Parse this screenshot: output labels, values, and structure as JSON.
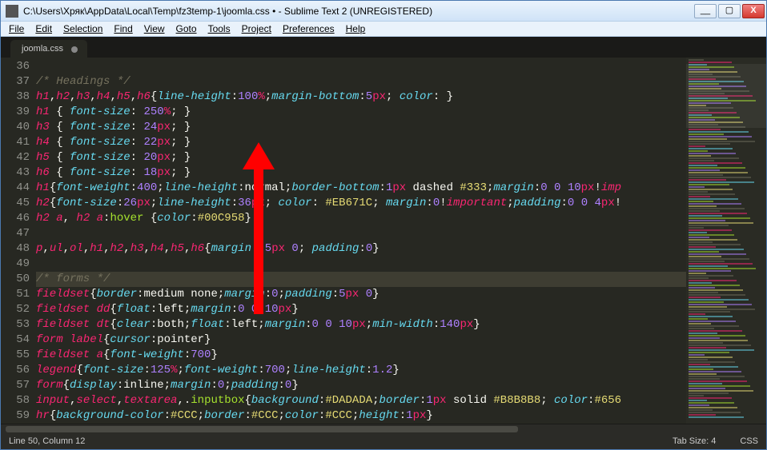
{
  "window": {
    "title": "C:\\Users\\Хряк\\AppData\\Local\\Temp\\fz3temp-1\\joomla.css • - Sublime Text 2 (UNREGISTERED)",
    "minimize": "__",
    "maximize": "▢",
    "close": "X"
  },
  "menu": {
    "file": "File",
    "edit": "Edit",
    "selection": "Selection",
    "find": "Find",
    "view": "View",
    "goto": "Goto",
    "tools": "Tools",
    "project": "Project",
    "preferences": "Preferences",
    "help": "Help"
  },
  "tab": {
    "name": "joomla.css"
  },
  "gutter_start": 36,
  "current_line": 50,
  "status": {
    "left": "Line 50, Column 12",
    "tabsize": "Tab Size: 4",
    "syntax": "CSS"
  },
  "code": [
    {
      "num": 36,
      "tokens": [
        [
          "",
          ""
        ]
      ]
    },
    {
      "num": 37,
      "tokens": [
        [
          "c-comment",
          "/* Headings */"
        ]
      ]
    },
    {
      "num": 38,
      "tokens": [
        [
          "c-sel",
          "h1"
        ],
        [
          "c-punc",
          ","
        ],
        [
          "c-sel",
          "h2"
        ],
        [
          "c-punc",
          ","
        ],
        [
          "c-sel",
          "h3"
        ],
        [
          "c-punc",
          ","
        ],
        [
          "c-sel",
          "h4"
        ],
        [
          "c-punc",
          ","
        ],
        [
          "c-sel",
          "h5"
        ],
        [
          "c-punc",
          ","
        ],
        [
          "c-sel",
          "h6"
        ],
        [
          "c-punc",
          "{"
        ],
        [
          "c-prop",
          "line-height"
        ],
        [
          "c-punc",
          ":"
        ],
        [
          "c-num",
          "100"
        ],
        [
          "c-unit",
          "%"
        ],
        [
          "c-punc",
          ";"
        ],
        [
          "c-prop",
          "margin-bottom"
        ],
        [
          "c-punc",
          ":"
        ],
        [
          "c-num",
          "5"
        ],
        [
          "c-unit",
          "px"
        ],
        [
          "c-punc",
          "; "
        ],
        [
          "c-prop",
          "color"
        ],
        [
          "c-punc",
          ": }"
        ]
      ]
    },
    {
      "num": 39,
      "tokens": [
        [
          "c-sel",
          "h1"
        ],
        [
          "c-punc",
          " { "
        ],
        [
          "c-prop",
          "font-size"
        ],
        [
          "c-punc",
          ": "
        ],
        [
          "c-num",
          "250"
        ],
        [
          "c-unit",
          "%"
        ],
        [
          "c-punc",
          "; }"
        ]
      ]
    },
    {
      "num": 40,
      "tokens": [
        [
          "c-sel",
          "h3"
        ],
        [
          "c-punc",
          " { "
        ],
        [
          "c-prop",
          "font-size"
        ],
        [
          "c-punc",
          ": "
        ],
        [
          "c-num",
          "24"
        ],
        [
          "c-unit",
          "px"
        ],
        [
          "c-punc",
          "; }"
        ]
      ]
    },
    {
      "num": 41,
      "tokens": [
        [
          "c-sel",
          "h4"
        ],
        [
          "c-punc",
          " { "
        ],
        [
          "c-prop",
          "font-size"
        ],
        [
          "c-punc",
          ": "
        ],
        [
          "c-num",
          "22"
        ],
        [
          "c-unit",
          "px"
        ],
        [
          "c-punc",
          "; }"
        ]
      ]
    },
    {
      "num": 42,
      "tokens": [
        [
          "c-sel",
          "h5"
        ],
        [
          "c-punc",
          " { "
        ],
        [
          "c-prop",
          "font-size"
        ],
        [
          "c-punc",
          ": "
        ],
        [
          "c-num",
          "20"
        ],
        [
          "c-unit",
          "px"
        ],
        [
          "c-punc",
          "; }"
        ]
      ]
    },
    {
      "num": 43,
      "tokens": [
        [
          "c-sel",
          "h6"
        ],
        [
          "c-punc",
          " { "
        ],
        [
          "c-prop",
          "font-size"
        ],
        [
          "c-punc",
          ": "
        ],
        [
          "c-num",
          "18"
        ],
        [
          "c-unit",
          "px"
        ],
        [
          "c-punc",
          "; }"
        ]
      ]
    },
    {
      "num": 44,
      "tokens": [
        [
          "c-sel",
          "h1"
        ],
        [
          "c-punc",
          "{"
        ],
        [
          "c-prop",
          "font-weight"
        ],
        [
          "c-punc",
          ":"
        ],
        [
          "c-num",
          "400"
        ],
        [
          "c-punc",
          ";"
        ],
        [
          "c-prop",
          "line-height"
        ],
        [
          "c-punc",
          ":normal;"
        ],
        [
          "c-prop",
          "border-bottom"
        ],
        [
          "c-punc",
          ":"
        ],
        [
          "c-num",
          "1"
        ],
        [
          "c-unit",
          "px"
        ],
        [
          "c-punc",
          " dashed "
        ],
        [
          "c-str",
          "#333"
        ],
        [
          "c-punc",
          ";"
        ],
        [
          "c-prop",
          "margin"
        ],
        [
          "c-punc",
          ":"
        ],
        [
          "c-num",
          "0"
        ],
        [
          "c-punc",
          " "
        ],
        [
          "c-num",
          "0"
        ],
        [
          "c-punc",
          " "
        ],
        [
          "c-num",
          "10"
        ],
        [
          "c-unit",
          "px"
        ],
        [
          "c-punc",
          "!"
        ],
        [
          "c-sel",
          "imp"
        ]
      ]
    },
    {
      "num": 45,
      "tokens": [
        [
          "c-sel",
          "h2"
        ],
        [
          "c-punc",
          "{"
        ],
        [
          "c-prop",
          "font-size"
        ],
        [
          "c-punc",
          ":"
        ],
        [
          "c-num",
          "26"
        ],
        [
          "c-unit",
          "px"
        ],
        [
          "c-punc",
          ";"
        ],
        [
          "c-prop",
          "line-height"
        ],
        [
          "c-punc",
          ":"
        ],
        [
          "c-num",
          "36"
        ],
        [
          "c-unit",
          "px"
        ],
        [
          "c-punc",
          "; "
        ],
        [
          "c-prop",
          "color"
        ],
        [
          "c-punc",
          ": "
        ],
        [
          "c-str",
          "#EB671C"
        ],
        [
          "c-punc",
          "; "
        ],
        [
          "c-prop",
          "margin"
        ],
        [
          "c-punc",
          ":"
        ],
        [
          "c-num",
          "0"
        ],
        [
          "c-punc",
          "!"
        ],
        [
          "c-sel",
          "important"
        ],
        [
          "c-punc",
          ";"
        ],
        [
          "c-prop",
          "padding"
        ],
        [
          "c-punc",
          ":"
        ],
        [
          "c-num",
          "0"
        ],
        [
          "c-punc",
          " "
        ],
        [
          "c-num",
          "0"
        ],
        [
          "c-punc",
          " "
        ],
        [
          "c-num",
          "4"
        ],
        [
          "c-unit",
          "px"
        ],
        [
          "c-punc",
          "!"
        ]
      ]
    },
    {
      "num": 46,
      "tokens": [
        [
          "c-sel",
          "h2 a"
        ],
        [
          "c-punc",
          ", "
        ],
        [
          "c-sel",
          "h2 a"
        ],
        [
          "c-punc",
          ":"
        ],
        [
          "c-name",
          "hover"
        ],
        [
          "c-punc",
          " {"
        ],
        [
          "c-prop",
          "color"
        ],
        [
          "c-punc",
          ":"
        ],
        [
          "c-str",
          "#00C958"
        ],
        [
          "c-punc",
          "}"
        ]
      ]
    },
    {
      "num": 47,
      "tokens": [
        [
          "",
          ""
        ]
      ]
    },
    {
      "num": 48,
      "tokens": [
        [
          "c-sel",
          "p"
        ],
        [
          "c-punc",
          ","
        ],
        [
          "c-sel",
          "ul"
        ],
        [
          "c-punc",
          ","
        ],
        [
          "c-sel",
          "ol"
        ],
        [
          "c-punc",
          ","
        ],
        [
          "c-sel",
          "h1"
        ],
        [
          "c-punc",
          ","
        ],
        [
          "c-sel",
          "h2"
        ],
        [
          "c-punc",
          ","
        ],
        [
          "c-sel",
          "h3"
        ],
        [
          "c-punc",
          ","
        ],
        [
          "c-sel",
          "h4"
        ],
        [
          "c-punc",
          ","
        ],
        [
          "c-sel",
          "h5"
        ],
        [
          "c-punc",
          ","
        ],
        [
          "c-sel",
          "h6"
        ],
        [
          "c-punc",
          "{"
        ],
        [
          "c-prop",
          "margin"
        ],
        [
          "c-punc",
          ": "
        ],
        [
          "c-num",
          "5"
        ],
        [
          "c-unit",
          "px"
        ],
        [
          "c-punc",
          " "
        ],
        [
          "c-num",
          "0"
        ],
        [
          "c-punc",
          "; "
        ],
        [
          "c-prop",
          "padding"
        ],
        [
          "c-punc",
          ":"
        ],
        [
          "c-num",
          "0"
        ],
        [
          "c-punc",
          "}"
        ]
      ]
    },
    {
      "num": 49,
      "tokens": [
        [
          "",
          ""
        ]
      ]
    },
    {
      "num": 50,
      "tokens": [
        [
          "c-comment",
          "/* forms */"
        ]
      ]
    },
    {
      "num": 51,
      "tokens": [
        [
          "c-sel",
          "fieldset"
        ],
        [
          "c-punc",
          "{"
        ],
        [
          "c-prop",
          "border"
        ],
        [
          "c-punc",
          ":medium none;"
        ],
        [
          "c-prop",
          "margin"
        ],
        [
          "c-punc",
          ":"
        ],
        [
          "c-num",
          "0"
        ],
        [
          "c-punc",
          ";"
        ],
        [
          "c-prop",
          "padding"
        ],
        [
          "c-punc",
          ":"
        ],
        [
          "c-num",
          "5"
        ],
        [
          "c-unit",
          "px"
        ],
        [
          "c-punc",
          " "
        ],
        [
          "c-num",
          "0"
        ],
        [
          "c-punc",
          "}"
        ]
      ]
    },
    {
      "num": 52,
      "tokens": [
        [
          "c-sel",
          "fieldset dd"
        ],
        [
          "c-punc",
          "{"
        ],
        [
          "c-prop",
          "float"
        ],
        [
          "c-punc",
          ":left;"
        ],
        [
          "c-prop",
          "margin"
        ],
        [
          "c-punc",
          ":"
        ],
        [
          "c-num",
          "0"
        ],
        [
          "c-punc",
          " "
        ],
        [
          "c-num",
          "0"
        ],
        [
          "c-punc",
          " "
        ],
        [
          "c-num",
          "10"
        ],
        [
          "c-unit",
          "px"
        ],
        [
          "c-punc",
          "}"
        ]
      ]
    },
    {
      "num": 53,
      "tokens": [
        [
          "c-sel",
          "fieldset dt"
        ],
        [
          "c-punc",
          "{"
        ],
        [
          "c-prop",
          "clear"
        ],
        [
          "c-punc",
          ":both;"
        ],
        [
          "c-prop",
          "float"
        ],
        [
          "c-punc",
          ":left;"
        ],
        [
          "c-prop",
          "margin"
        ],
        [
          "c-punc",
          ":"
        ],
        [
          "c-num",
          "0"
        ],
        [
          "c-punc",
          " "
        ],
        [
          "c-num",
          "0"
        ],
        [
          "c-punc",
          " "
        ],
        [
          "c-num",
          "10"
        ],
        [
          "c-unit",
          "px"
        ],
        [
          "c-punc",
          ";"
        ],
        [
          "c-prop",
          "min-width"
        ],
        [
          "c-punc",
          ":"
        ],
        [
          "c-num",
          "140"
        ],
        [
          "c-unit",
          "px"
        ],
        [
          "c-punc",
          "}"
        ]
      ]
    },
    {
      "num": 54,
      "tokens": [
        [
          "c-sel",
          "form label"
        ],
        [
          "c-punc",
          "{"
        ],
        [
          "c-prop",
          "cursor"
        ],
        [
          "c-punc",
          ":pointer}"
        ]
      ]
    },
    {
      "num": 55,
      "tokens": [
        [
          "c-sel",
          "fieldset a"
        ],
        [
          "c-punc",
          "{"
        ],
        [
          "c-prop",
          "font-weight"
        ],
        [
          "c-punc",
          ":"
        ],
        [
          "c-num",
          "700"
        ],
        [
          "c-punc",
          "}"
        ]
      ]
    },
    {
      "num": 56,
      "tokens": [
        [
          "c-sel",
          "legend"
        ],
        [
          "c-punc",
          "{"
        ],
        [
          "c-prop",
          "font-size"
        ],
        [
          "c-punc",
          ":"
        ],
        [
          "c-num",
          "125"
        ],
        [
          "c-unit",
          "%"
        ],
        [
          "c-punc",
          ";"
        ],
        [
          "c-prop",
          "font-weight"
        ],
        [
          "c-punc",
          ":"
        ],
        [
          "c-num",
          "700"
        ],
        [
          "c-punc",
          ";"
        ],
        [
          "c-prop",
          "line-height"
        ],
        [
          "c-punc",
          ":"
        ],
        [
          "c-num",
          "1.2"
        ],
        [
          "c-punc",
          "}"
        ]
      ]
    },
    {
      "num": 57,
      "tokens": [
        [
          "c-sel",
          "form"
        ],
        [
          "c-punc",
          "{"
        ],
        [
          "c-prop",
          "display"
        ],
        [
          "c-punc",
          ":inline;"
        ],
        [
          "c-prop",
          "margin"
        ],
        [
          "c-punc",
          ":"
        ],
        [
          "c-num",
          "0"
        ],
        [
          "c-punc",
          ";"
        ],
        [
          "c-prop",
          "padding"
        ],
        [
          "c-punc",
          ":"
        ],
        [
          "c-num",
          "0"
        ],
        [
          "c-punc",
          "}"
        ]
      ]
    },
    {
      "num": 58,
      "tokens": [
        [
          "c-sel",
          "input"
        ],
        [
          "c-punc",
          ","
        ],
        [
          "c-sel",
          "select"
        ],
        [
          "c-punc",
          ","
        ],
        [
          "c-sel",
          "textarea"
        ],
        [
          "c-punc",
          ",."
        ],
        [
          "c-name",
          "inputbox"
        ],
        [
          "c-punc",
          "{"
        ],
        [
          "c-prop",
          "background"
        ],
        [
          "c-punc",
          ":"
        ],
        [
          "c-str",
          "#DADADA"
        ],
        [
          "c-punc",
          ";"
        ],
        [
          "c-prop",
          "border"
        ],
        [
          "c-punc",
          ":"
        ],
        [
          "c-num",
          "1"
        ],
        [
          "c-unit",
          "px"
        ],
        [
          "c-punc",
          " solid "
        ],
        [
          "c-str",
          "#B8B8B8"
        ],
        [
          "c-punc",
          "; "
        ],
        [
          "c-prop",
          "color"
        ],
        [
          "c-punc",
          ":"
        ],
        [
          "c-str",
          "#656"
        ]
      ]
    },
    {
      "num": 59,
      "tokens": [
        [
          "c-sel",
          "hr"
        ],
        [
          "c-punc",
          "{"
        ],
        [
          "c-prop",
          "background-color"
        ],
        [
          "c-punc",
          ":"
        ],
        [
          "c-str",
          "#CCC"
        ],
        [
          "c-punc",
          ";"
        ],
        [
          "c-prop",
          "border"
        ],
        [
          "c-punc",
          ":"
        ],
        [
          "c-str",
          "#CCC"
        ],
        [
          "c-punc",
          ";"
        ],
        [
          "c-prop",
          "color"
        ],
        [
          "c-punc",
          ":"
        ],
        [
          "c-str",
          "#CCC"
        ],
        [
          "c-punc",
          ";"
        ],
        [
          "c-prop",
          "height"
        ],
        [
          "c-punc",
          ":"
        ],
        [
          "c-num",
          "1"
        ],
        [
          "c-unit",
          "px"
        ],
        [
          "c-punc",
          "}"
        ]
      ]
    }
  ]
}
